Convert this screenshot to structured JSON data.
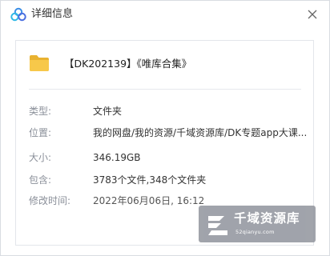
{
  "window": {
    "title": "详细信息",
    "close_glyph": "✕"
  },
  "file": {
    "name": "【DK202139】《唯库合集》",
    "icon": "folder-icon"
  },
  "properties": [
    {
      "label": "类型:",
      "value": "文件夹"
    },
    {
      "label": "位置:",
      "value": "我的网盘/我的资源/千域资源库/DK专题app大课..."
    },
    {
      "label": "大小:",
      "value": "346.19GB"
    },
    {
      "label": "包含:",
      "value": "3783个文件,348个文件夹"
    },
    {
      "label": "修改时间:",
      "value": "2022年06月06日, 16:12"
    }
  ],
  "watermark": {
    "name": "千域资源库",
    "url": "52qianyu.com"
  },
  "colors": {
    "brand": "#3a8ee6",
    "folder": "#f7c84a",
    "folder_dark": "#e9b230",
    "watermark_bg": "#8c9099"
  }
}
